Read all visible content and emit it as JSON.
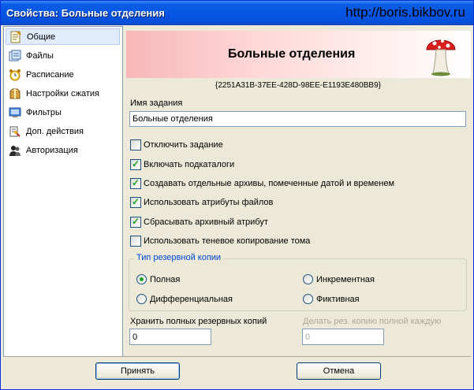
{
  "window": {
    "title": "Свойства: Больные отделения",
    "watermark": "http://boris.bikbov.ru"
  },
  "sidebar": {
    "items": [
      {
        "label": "Общие",
        "icon": "general-icon",
        "selected": true
      },
      {
        "label": "Файлы",
        "icon": "files-icon",
        "selected": false
      },
      {
        "label": "Расписание",
        "icon": "alarm-clock-icon",
        "selected": false
      },
      {
        "label": "Настройки сжатия",
        "icon": "compression-icon",
        "selected": false
      },
      {
        "label": "Фильтры",
        "icon": "filter-monitor-icon",
        "selected": false
      },
      {
        "label": "Доп. действия",
        "icon": "actions-icon",
        "selected": false
      },
      {
        "label": "Авторизация",
        "icon": "users-icon",
        "selected": false
      }
    ]
  },
  "header": {
    "title": "Больные отделения",
    "guid": "{2251A31B-37EE-428D-98EE-E1193E480BB9}",
    "mascot": "mushroom-icon"
  },
  "form": {
    "task_name_label": "Имя задания",
    "task_name_value": "Больные отделения",
    "checkboxes": [
      {
        "label": "Отключить задание",
        "checked": false
      },
      {
        "label": "Включать подкаталоги",
        "checked": true
      },
      {
        "label": "Создавать отдельные архивы, помеченные датой и временем",
        "checked": true
      },
      {
        "label": "Использовать атрибуты файлов",
        "checked": true
      },
      {
        "label": "Сбрасывать архивный атрибут",
        "checked": true
      },
      {
        "label": "Использовать теневое копирование тома",
        "checked": false
      }
    ],
    "backup_type": {
      "title": "Тип резервной копии",
      "options": [
        {
          "label": "Полная",
          "selected": true
        },
        {
          "label": "Инкрементная",
          "selected": false
        },
        {
          "label": "Дифференциальная",
          "selected": false
        },
        {
          "label": "Фиктивная",
          "selected": false
        }
      ]
    },
    "keep_full_label": "Хранить полных резервных копий",
    "keep_full_value": "0",
    "full_every_label": "Делать рез. копию полной каждую",
    "full_every_value": "0"
  },
  "buttons": {
    "accept": "Принять",
    "cancel": "Отмена"
  },
  "colors": {
    "titlebar": "#0554e3",
    "check": "#21a121",
    "group_title": "#0046d5"
  }
}
